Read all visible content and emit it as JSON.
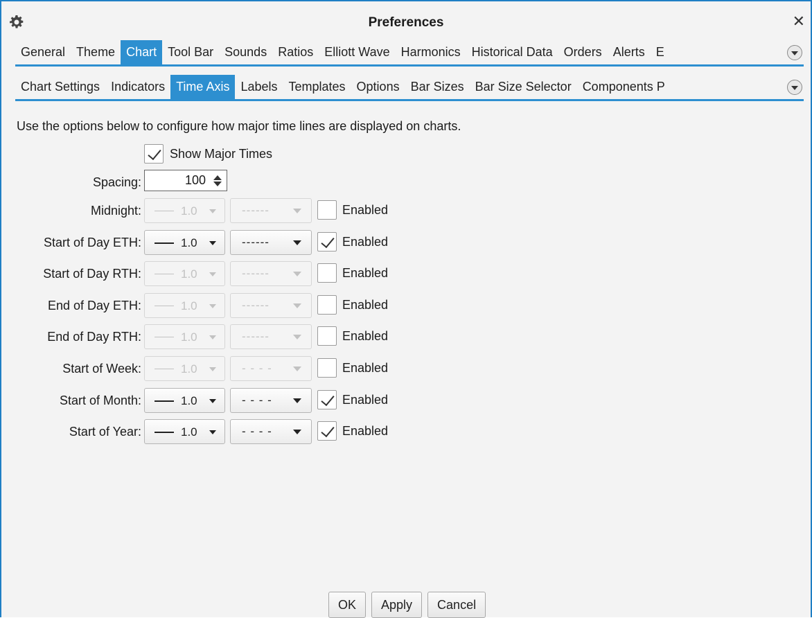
{
  "window": {
    "title": "Preferences"
  },
  "top_tabs": [
    {
      "label": "General",
      "active": false
    },
    {
      "label": "Theme",
      "active": false
    },
    {
      "label": "Chart",
      "active": true
    },
    {
      "label": "Tool Bar",
      "active": false
    },
    {
      "label": "Sounds",
      "active": false
    },
    {
      "label": "Ratios",
      "active": false
    },
    {
      "label": "Elliott Wave",
      "active": false
    },
    {
      "label": "Harmonics",
      "active": false
    },
    {
      "label": "Historical Data",
      "active": false
    },
    {
      "label": "Orders",
      "active": false
    },
    {
      "label": "Alerts",
      "active": false
    },
    {
      "label": "E",
      "active": false
    }
  ],
  "sub_tabs": [
    {
      "label": "Chart Settings",
      "active": false
    },
    {
      "label": "Indicators",
      "active": false
    },
    {
      "label": "Time Axis",
      "active": true
    },
    {
      "label": "Labels",
      "active": false
    },
    {
      "label": "Templates",
      "active": false
    },
    {
      "label": "Options",
      "active": false
    },
    {
      "label": "Bar Sizes",
      "active": false
    },
    {
      "label": "Bar Size Selector",
      "active": false
    },
    {
      "label": "Components P",
      "active": false
    }
  ],
  "description": "Use the options below to configure how major time lines are displayed on charts.",
  "show_major_times": {
    "label": "Show Major Times",
    "checked": true
  },
  "spacing": {
    "label": "Spacing:",
    "value": "100"
  },
  "enabled_label": "Enabled",
  "time_lines": [
    {
      "label": "Midnight:",
      "width": "1.0",
      "style": "------",
      "enabled": false
    },
    {
      "label": "Start of Day ETH:",
      "width": "1.0",
      "style": "------",
      "enabled": true
    },
    {
      "label": "Start of Day RTH:",
      "width": "1.0",
      "style": "------",
      "enabled": false
    },
    {
      "label": "End of Day ETH:",
      "width": "1.0",
      "style": "------",
      "enabled": false
    },
    {
      "label": "End of Day RTH:",
      "width": "1.0",
      "style": "------",
      "enabled": false
    },
    {
      "label": "Start of Week:",
      "width": "1.0",
      "style": "- - - -",
      "enabled": false
    },
    {
      "label": "Start of Month:",
      "width": "1.0",
      "style": "- - - -",
      "enabled": true
    },
    {
      "label": "Start of Year:",
      "width": "1.0",
      "style": "- - - -",
      "enabled": true
    }
  ],
  "buttons": {
    "ok": "OK",
    "apply": "Apply",
    "cancel": "Cancel"
  },
  "colors": {
    "accent": "#2d8fd0",
    "window_border": "#1f7fc4",
    "background": "#f3f3f3"
  }
}
